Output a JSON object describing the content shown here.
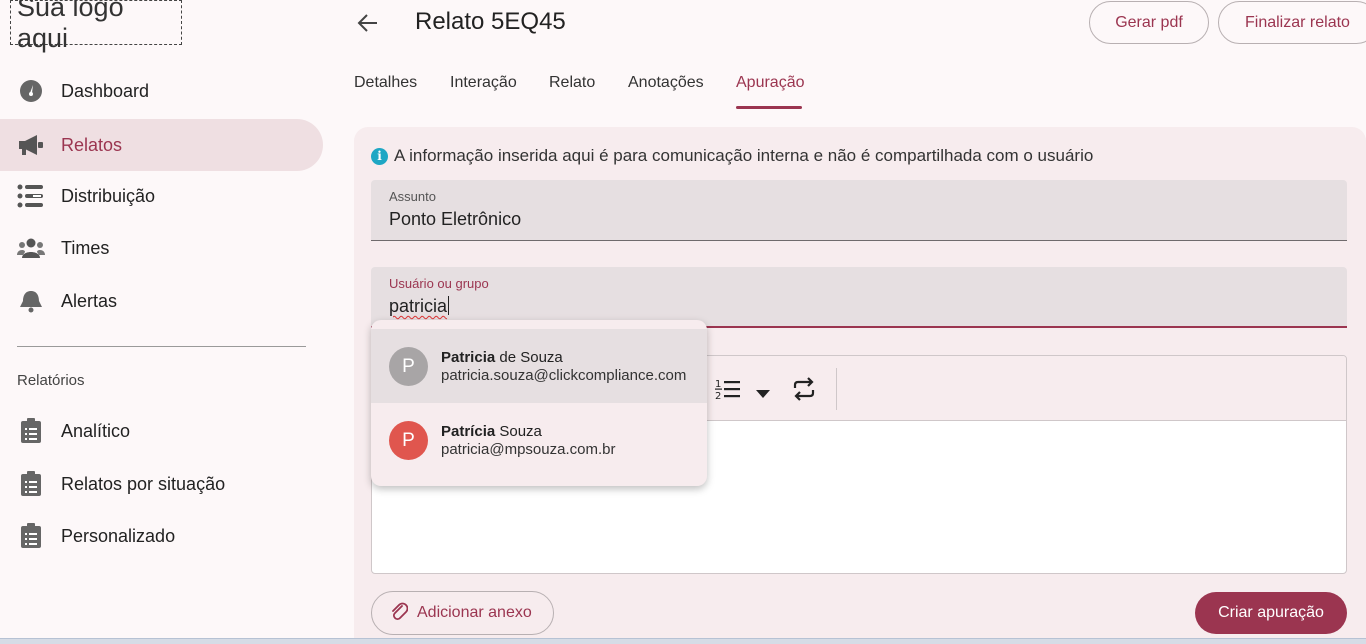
{
  "logo": {
    "text": "Sua logo aqui"
  },
  "sidebar": {
    "items": [
      {
        "label": "Dashboard",
        "icon": "dashboard-icon"
      },
      {
        "label": "Relatos",
        "icon": "megaphone-icon",
        "active": true
      },
      {
        "label": "Distribuição",
        "icon": "distribution-icon"
      },
      {
        "label": "Times",
        "icon": "people-icon"
      },
      {
        "label": "Alertas",
        "icon": "bell-icon"
      }
    ],
    "section_title": "Relatórios",
    "report_items": [
      {
        "label": "Analítico",
        "icon": "clipboard-icon"
      },
      {
        "label": "Relatos por situação",
        "icon": "clipboard-icon"
      },
      {
        "label": "Personalizado",
        "icon": "clipboard-icon"
      }
    ]
  },
  "header": {
    "title": "Relato 5EQ45",
    "gerar_pdf": "Gerar pdf",
    "finalizar": "Finalizar relato"
  },
  "tabs": [
    {
      "label": "Detalhes"
    },
    {
      "label": "Interação"
    },
    {
      "label": "Relato"
    },
    {
      "label": "Anotações"
    },
    {
      "label": "Apuração",
      "active": true
    }
  ],
  "info": {
    "text": "A informação inserida aqui é para comunicação interna e não é compartilhada com o usuário"
  },
  "fields": {
    "subject": {
      "label": "Assunto",
      "value": "Ponto Eletrônico"
    },
    "user": {
      "label": "Usuário ou grupo",
      "value": "patricia"
    }
  },
  "suggestions": [
    {
      "initial": "P",
      "name_bold": "Patricia",
      "name_rest": " de Souza",
      "email": "patricia.souza@clickcompliance.com",
      "color": "#a8a5a6"
    },
    {
      "initial": "P",
      "name_bold": "Patrícia",
      "name_rest": " Souza",
      "email": "patricia@mpsouza.com.br",
      "color": "#e0564e"
    }
  ],
  "actions": {
    "attach": "Adicionar anexo",
    "create": "Criar apuração"
  },
  "colors": {
    "accent": "#9b3550",
    "active_bg": "#efdfe2",
    "info": "#1ea7c4"
  }
}
